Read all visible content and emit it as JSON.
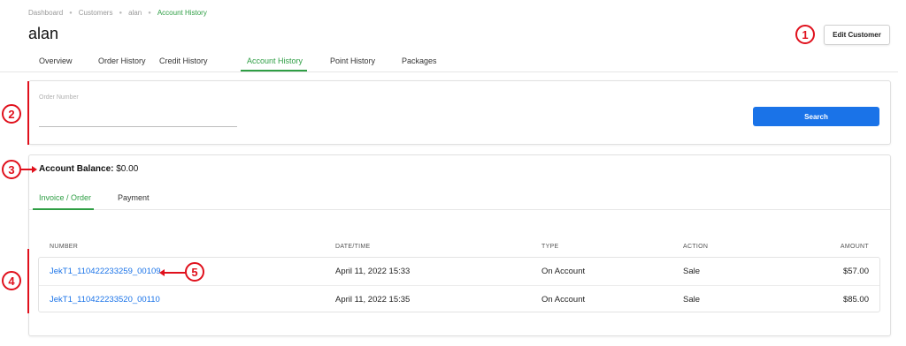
{
  "breadcrumb": [
    {
      "label": "Dashboard"
    },
    {
      "label": "Customers"
    },
    {
      "label": "alan"
    },
    {
      "label": "Account History"
    }
  ],
  "page_title": "alan",
  "edit_button": "Edit Customer",
  "tabs": [
    {
      "label": "Overview"
    },
    {
      "label": "Order History"
    },
    {
      "label": "Credit History"
    },
    {
      "label": "Account History"
    },
    {
      "label": "Point History"
    },
    {
      "label": "Packages"
    }
  ],
  "search": {
    "label": "Order Number",
    "value": "",
    "button": "Search"
  },
  "balance": {
    "label": "Account Balance:",
    "amount": "$0.00"
  },
  "subtabs": [
    {
      "label": "Invoice / Order"
    },
    {
      "label": "Payment"
    }
  ],
  "table": {
    "headers": [
      "NUMBER",
      "DATE/TIME",
      "TYPE",
      "ACTION",
      "AMOUNT"
    ],
    "rows": [
      {
        "number": "JekT1_110422233259_00109",
        "datetime": "April 11, 2022 15:33",
        "type": "On Account",
        "action": "Sale",
        "amount": "$57.00"
      },
      {
        "number": "JekT1_110422233520_00110",
        "datetime": "April 11, 2022 15:35",
        "type": "On Account",
        "action": "Sale",
        "amount": "$85.00"
      }
    ]
  },
  "markers": [
    "1",
    "2",
    "3",
    "4",
    "5"
  ],
  "colors": {
    "accent_green": "#2e9e44",
    "link_blue": "#1a73e8",
    "annotation_red": "#e0101c"
  }
}
